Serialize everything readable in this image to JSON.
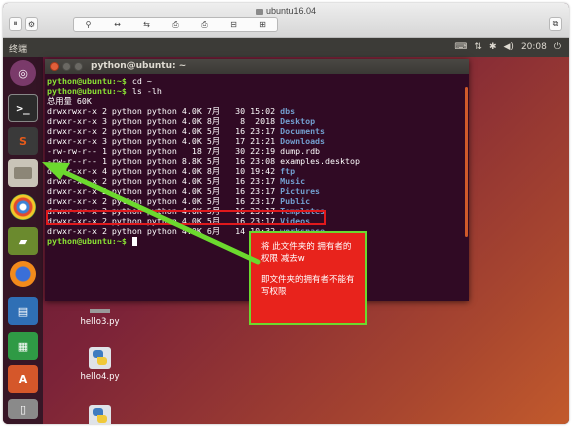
{
  "vm": {
    "window_title": "ubuntu16.04",
    "toolbar_buttons": [
      "⚲",
      "↔",
      "⇆",
      "⎙",
      "⎙",
      "⊟",
      "⊞"
    ]
  },
  "panel": {
    "app_name": "终端",
    "clock": "20:08",
    "tray_icons": [
      "keyboard-icon",
      "network-icon",
      "bluetooth-icon",
      "volume-icon",
      "power-icon"
    ]
  },
  "terminal": {
    "title": "python@ubuntu: ~",
    "prompt": "python@ubuntu:~$",
    "lines": [
      {
        "kind": "cmd",
        "cmd": " cd ~"
      },
      {
        "kind": "cmd",
        "cmd": " ls -lh"
      },
      {
        "kind": "text",
        "text": "总用量 60K"
      },
      {
        "kind": "entry",
        "meta": "drwxrwxr-x 2 python python 4.0K 7月   30 15:02 ",
        "name": "dbs",
        "is_dir": true
      },
      {
        "kind": "entry",
        "meta": "drwxr-xr-x 3 python python 4.0K 8月    8  2018 ",
        "name": "Desktop",
        "is_dir": true
      },
      {
        "kind": "entry",
        "meta": "drwxr-xr-x 2 python python 4.0K 5月   16 23:17 ",
        "name": "Documents",
        "is_dir": true
      },
      {
        "kind": "entry",
        "meta": "drwxr-xr-x 3 python python 4.0K 5月   17 21:21 ",
        "name": "Downloads",
        "is_dir": true
      },
      {
        "kind": "entry",
        "meta": "-rw-rw-r-- 1 python python   18 7月   30 22:19 ",
        "name": "dump.rdb",
        "is_dir": false
      },
      {
        "kind": "entry",
        "meta": "-rw-r--r-- 1 python python 8.8K 5月   16 23:08 ",
        "name": "examples.desktop",
        "is_dir": false
      },
      {
        "kind": "entry",
        "meta": "dr-xr-xr-x 4 python python 4.0K 8月   10 19:42 ",
        "name": "ftp",
        "is_dir": true
      },
      {
        "kind": "entry",
        "meta": "drwxr-xr-x 2 python python 4.0K 5月   16 23:17 ",
        "name": "Music",
        "is_dir": true
      },
      {
        "kind": "entry",
        "meta": "drwxr-xr-x 2 python python 4.0K 5月   16 23:17 ",
        "name": "Pictures",
        "is_dir": true
      },
      {
        "kind": "entry",
        "meta": "drwxr-xr-x 2 python python 4.0K 5月   16 23:17 ",
        "name": "Public",
        "is_dir": true
      },
      {
        "kind": "entry",
        "meta": "drwxr-xr-x 2 python python 4.0K 5月   16 23:17 ",
        "name": "Templates",
        "is_dir": true
      },
      {
        "kind": "entry",
        "meta": "drwxr-xr-x 2 python python 4.0K 5月   16 23:17 ",
        "name": "Videos",
        "is_dir": true
      },
      {
        "kind": "entry",
        "meta": "drwxr-xr-x 2 python python 4.0K 6月   14 10:32 ",
        "name": "workspace",
        "is_dir": true
      },
      {
        "kind": "prompt"
      }
    ]
  },
  "desktop": {
    "files": [
      "hello3.py",
      "hello4.py"
    ]
  },
  "annotation": {
    "line1": "将 此文件夹的 拥有者的权限 减去w",
    "line2": "即文件夹的拥有者不能有写权限"
  },
  "colors": {
    "prompt": "#8ae234",
    "directory": "#729fcf",
    "highlight": "#e0191c",
    "arrow": "#6cd92e",
    "annotation_bg": "#e8231c"
  }
}
